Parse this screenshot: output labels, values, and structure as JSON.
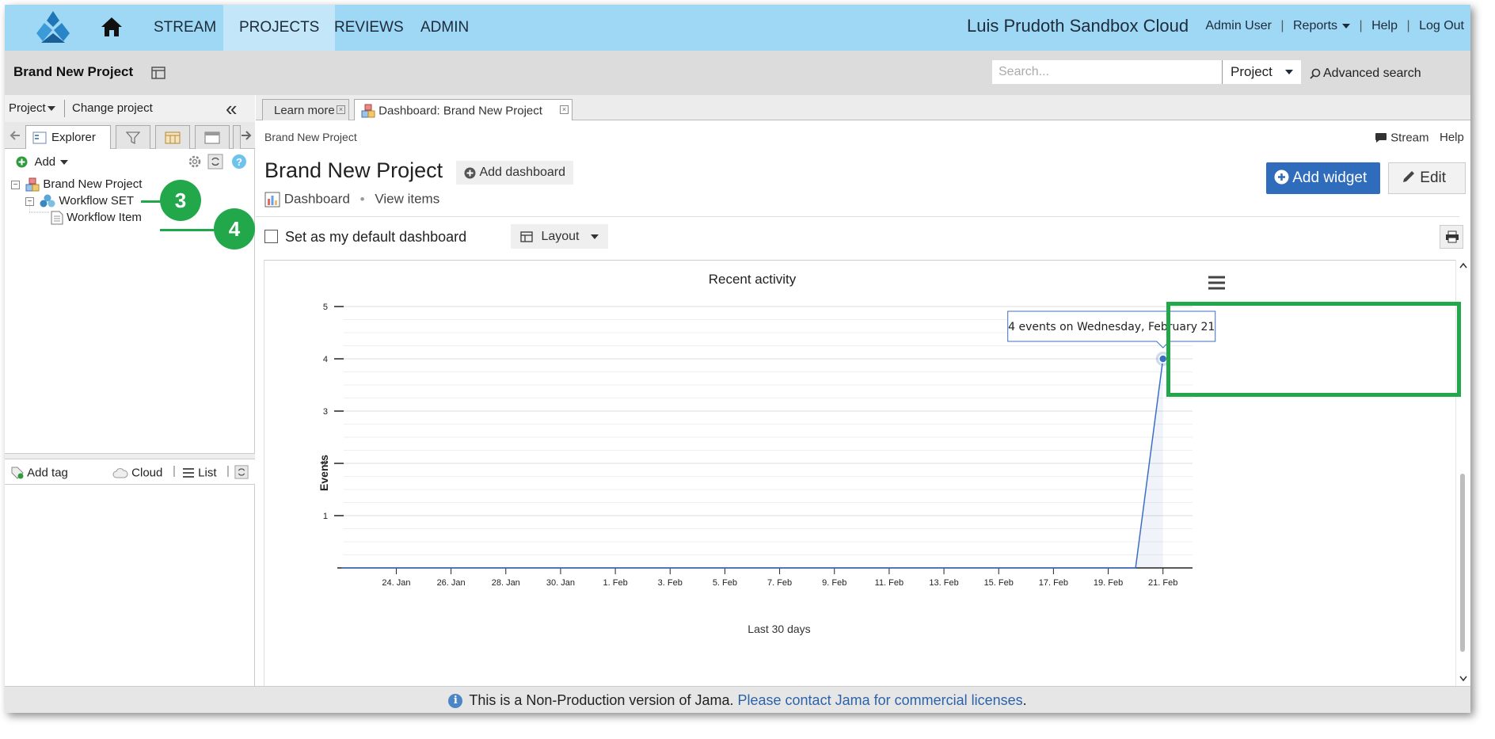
{
  "topnav": {
    "tabs": [
      "STREAM",
      "PROJECTS",
      "REVIEWS",
      "ADMIN"
    ],
    "instance_title": "Luis Prudoth Sandbox Cloud",
    "user": "Admin User",
    "reports": "Reports",
    "help": "Help",
    "logout": "Log Out",
    "colors": {
      "bar": "#9ed8f5",
      "active_tab": "#c3e7f9"
    }
  },
  "projectbar": {
    "title": "Brand New Project",
    "search_placeholder": "Search...",
    "scope": "Project",
    "advanced_search": "Advanced search"
  },
  "leftpanel": {
    "project_dropdown": "Project",
    "change_project": "Change project",
    "explorer_tab": "Explorer",
    "add_label": "Add",
    "tree": [
      {
        "label": "Brand New Project",
        "icon": "project-icon"
      },
      {
        "label": "Workflow SET",
        "icon": "set-icon"
      },
      {
        "label": "Workflow Item",
        "icon": "document-icon"
      }
    ],
    "tags": {
      "add_tag": "Add tag",
      "cloud": "Cloud",
      "list": "List"
    }
  },
  "annotations": {
    "callout_3": "3",
    "callout_4": "4",
    "color": "#22a84a"
  },
  "main": {
    "tabs": [
      "Learn more",
      "Dashboard: Brand New Project"
    ],
    "breadcrumb": "Brand New Project",
    "stream_link": "Stream",
    "help_link": "Help",
    "title": "Brand New Project",
    "add_dashboard": "Add dashboard",
    "add_widget": "Add widget",
    "edit": "Edit",
    "subnav_dashboard": "Dashboard",
    "subnav_view_items": "View items",
    "default_checkbox_label": "Set as my default dashboard",
    "layout": "Layout"
  },
  "chart_data": {
    "type": "line",
    "title": "Recent activity",
    "xlabel": "Last 30 days",
    "ylabel": "Events",
    "ylim": [
      0,
      5
    ],
    "yticks": [
      1,
      2,
      3,
      4,
      5
    ],
    "x_tick_labels": [
      "24. Jan",
      "26. Jan",
      "28. Jan",
      "30. Jan",
      "1. Feb",
      "3. Feb",
      "5. Feb",
      "7. Feb",
      "9. Feb",
      "11. Feb",
      "13. Feb",
      "15. Feb",
      "17. Feb",
      "19. Feb",
      "21. Feb"
    ],
    "x": [
      "22. Jan",
      "23. Jan",
      "24. Jan",
      "25. Jan",
      "26. Jan",
      "27. Jan",
      "28. Jan",
      "29. Jan",
      "30. Jan",
      "31. Jan",
      "1. Feb",
      "2. Feb",
      "3. Feb",
      "4. Feb",
      "5. Feb",
      "6. Feb",
      "7. Feb",
      "8. Feb",
      "9. Feb",
      "10. Feb",
      "11. Feb",
      "12. Feb",
      "13. Feb",
      "14. Feb",
      "15. Feb",
      "16. Feb",
      "17. Feb",
      "18. Feb",
      "19. Feb",
      "20. Feb",
      "21. Feb"
    ],
    "series": [
      {
        "values": [
          0,
          0,
          0,
          0,
          0,
          0,
          0,
          0,
          0,
          0,
          0,
          0,
          0,
          0,
          0,
          0,
          0,
          0,
          0,
          0,
          0,
          0,
          0,
          0,
          0,
          0,
          0,
          0,
          0,
          0,
          4
        ],
        "color": "#3b6fc4"
      }
    ],
    "tooltip": "4 events on Wednesday, February 21",
    "grid": true
  },
  "footer": {
    "text": "This is a Non-Production version of Jama.",
    "link": "Please contact Jama for commercial licenses",
    "end": "."
  }
}
